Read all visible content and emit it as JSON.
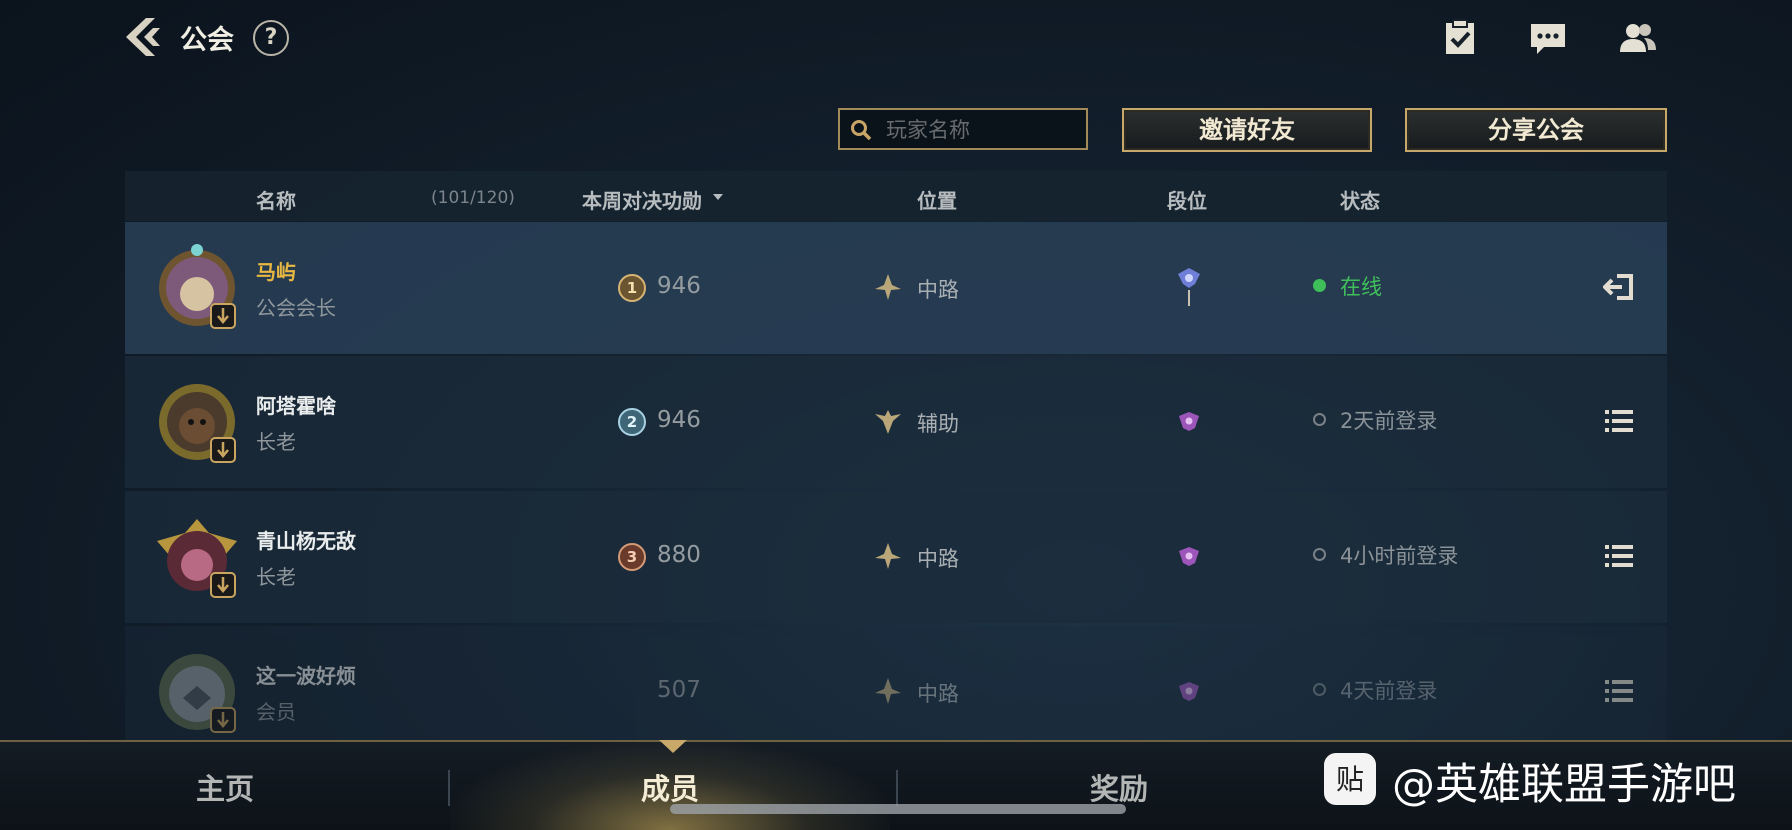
{
  "header": {
    "title": "公会",
    "help_symbol": "?"
  },
  "toolbar": {
    "search_placeholder": "玩家名称",
    "invite_label": "邀请好友",
    "share_label": "分享公会"
  },
  "table": {
    "columns": {
      "name": "名称",
      "count": "(101/120)",
      "merit": "本周对决功勋",
      "position": "位置",
      "rank": "段位",
      "status": "状态"
    },
    "rows": [
      {
        "name": "马屿",
        "role": "公会会长",
        "medal": "1",
        "merit": "946",
        "position": "中路",
        "status": "在线",
        "online": true
      },
      {
        "name": "阿塔霍啥",
        "role": "长老",
        "medal": "2",
        "merit": "946",
        "position": "辅助",
        "status": "2天前登录",
        "online": false
      },
      {
        "name": "青山杨无敌",
        "role": "长老",
        "medal": "3",
        "merit": "880",
        "position": "中路",
        "status": "4小时前登录",
        "online": false
      },
      {
        "name": "这一波好烦",
        "role": "会员",
        "medal": "",
        "merit": "507",
        "position": "中路",
        "status": "4天前登录",
        "online": false
      }
    ]
  },
  "bottom_nav": {
    "home": "主页",
    "members": "成员",
    "rewards": "奖励"
  },
  "watermark": {
    "logo_glyph": "贴",
    "text": "@英雄联盟手游吧"
  },
  "side_id": "48762619",
  "colors": {
    "gold_accent": "#c6a86a",
    "leader_name": "#e8b842",
    "online_green": "#3fbf5a",
    "background": "#13202d"
  },
  "icons": [
    "back-arrow-icon",
    "help-icon",
    "tasks-icon",
    "chat-icon",
    "friends-icon",
    "search-icon",
    "mid-lane-icon",
    "support-icon",
    "rank-emblem-icon",
    "exit-guild-icon",
    "list-menu-icon"
  ]
}
